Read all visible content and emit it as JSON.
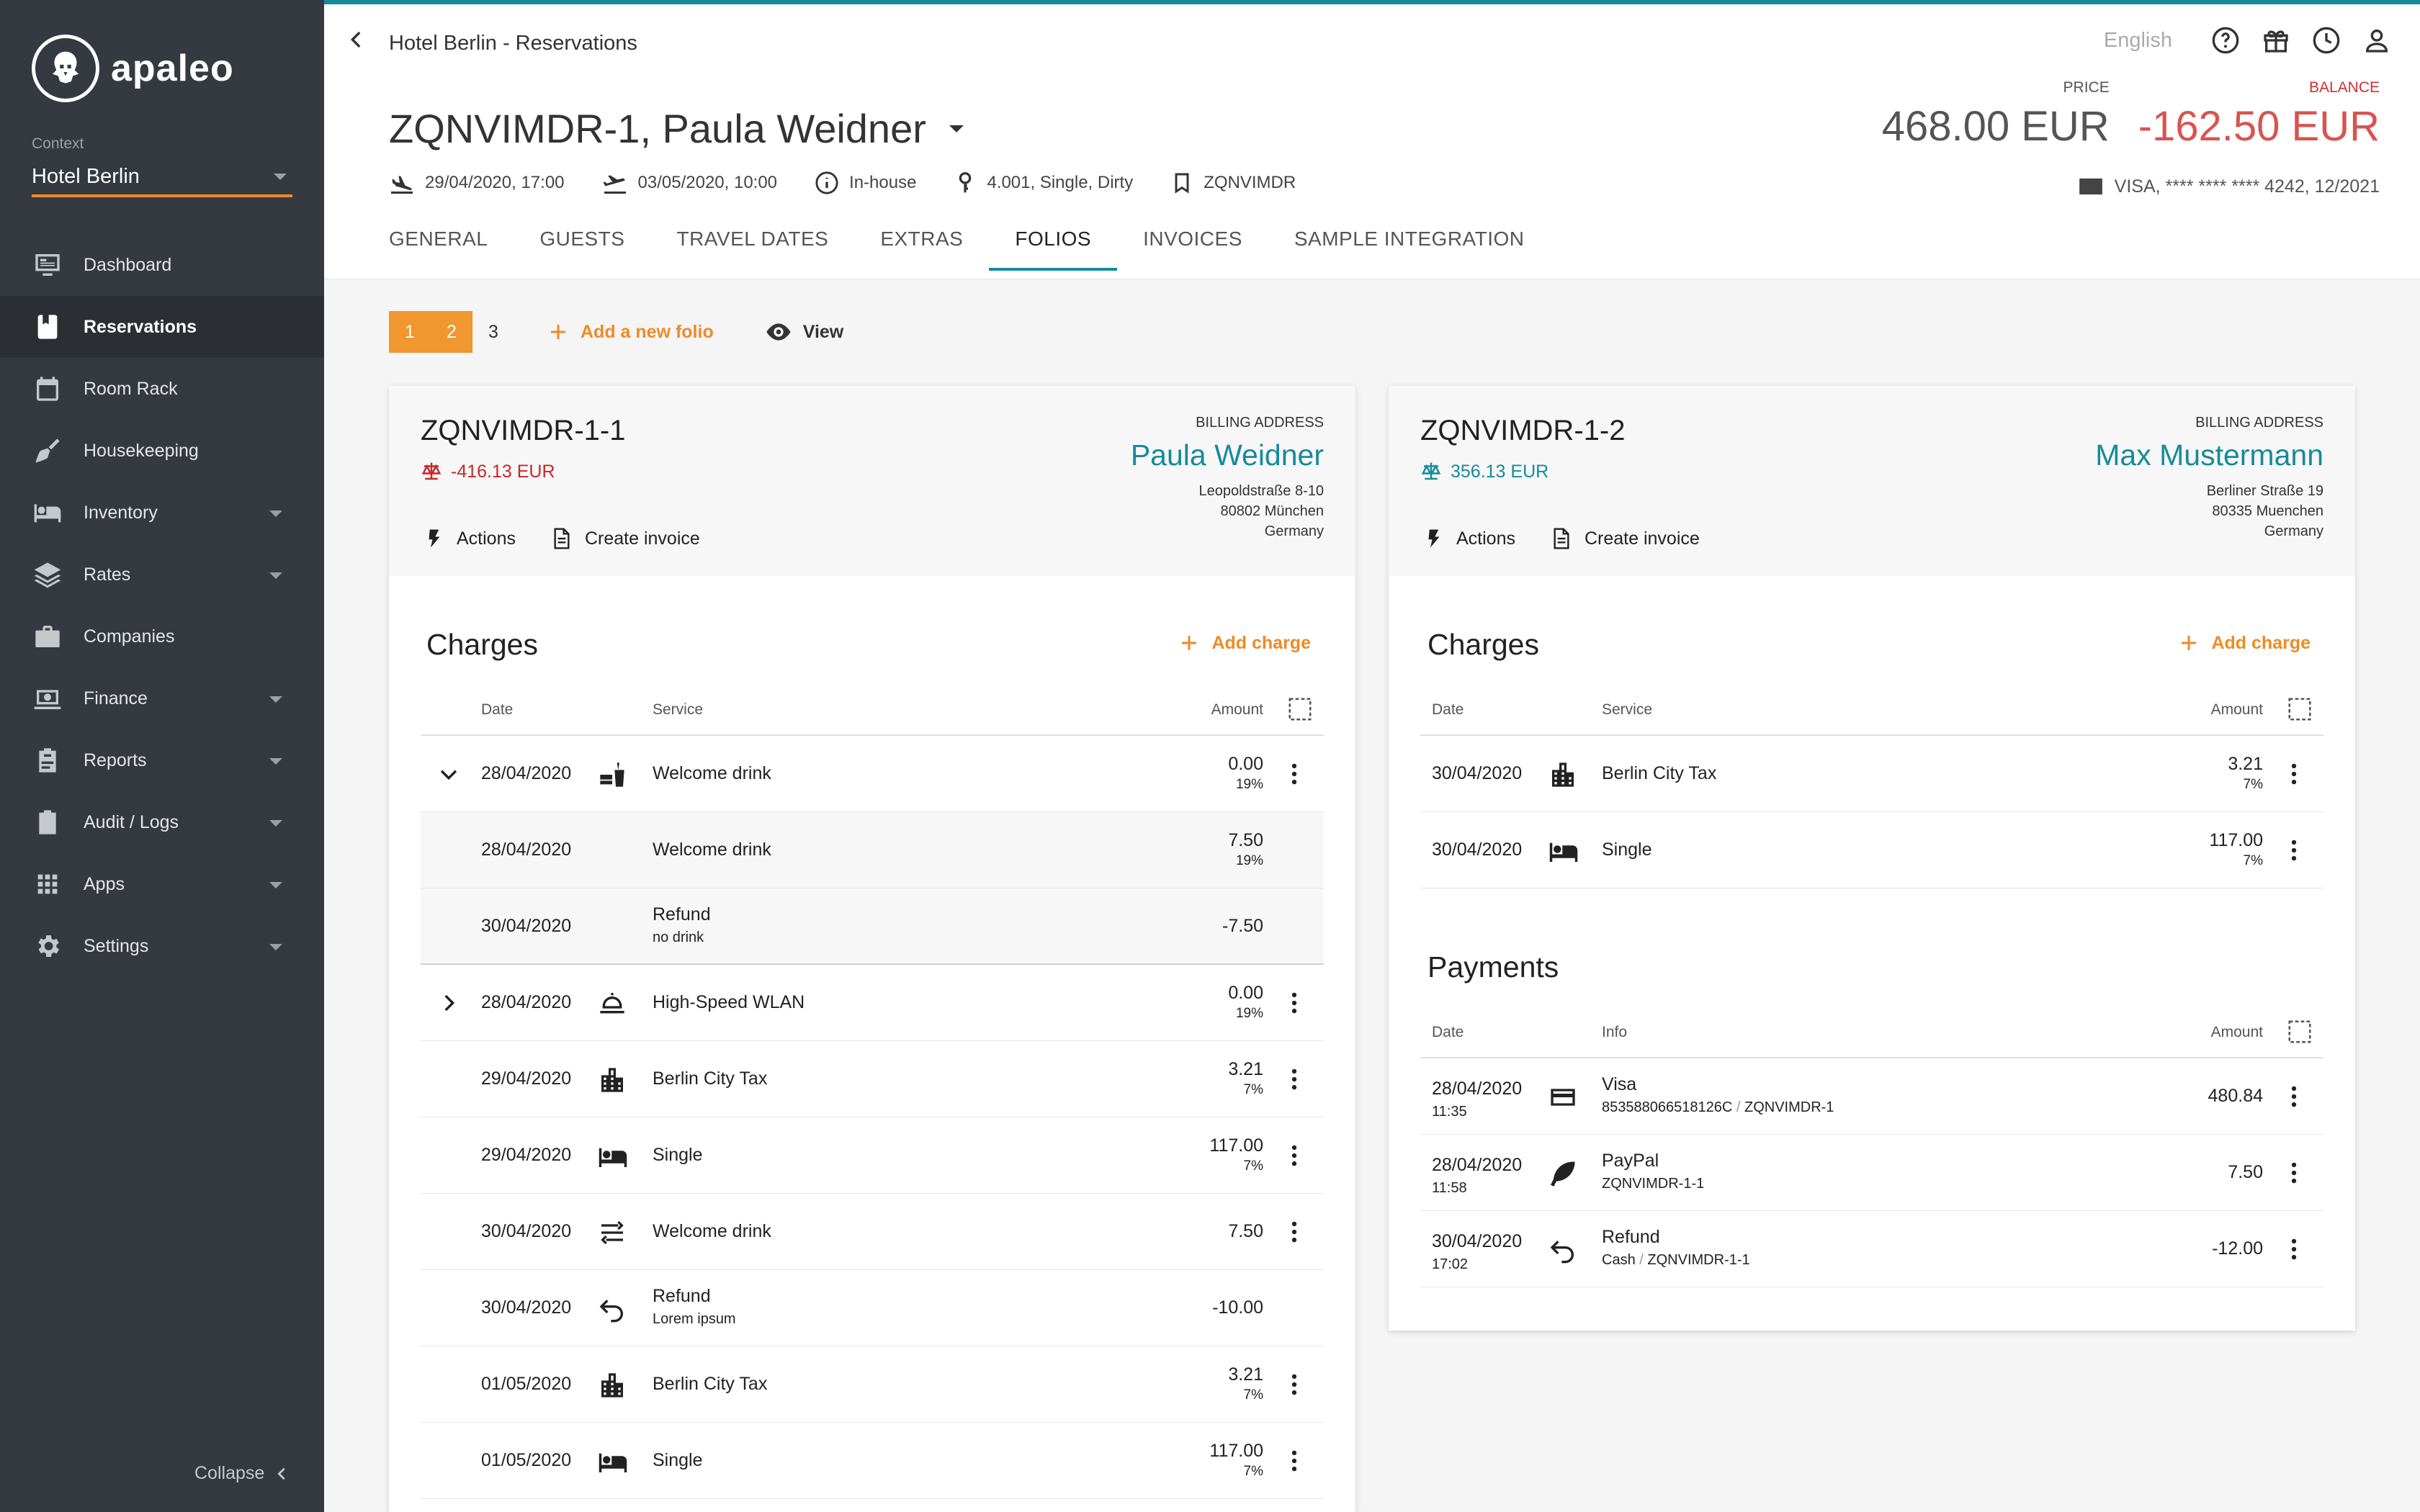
{
  "app": {
    "logo": "apaleo",
    "context_label": "Context",
    "context_value": "Hotel Berlin",
    "collapse": "Collapse"
  },
  "nav": [
    {
      "label": "Dashboard",
      "icon": "dashboard-icon"
    },
    {
      "label": "Reservations",
      "icon": "reservations-icon",
      "active": true
    },
    {
      "label": "Room Rack",
      "icon": "room-rack-icon"
    },
    {
      "label": "Housekeeping",
      "icon": "housekeeping-icon"
    },
    {
      "label": "Inventory",
      "icon": "inventory-icon",
      "caret": true
    },
    {
      "label": "Rates",
      "icon": "rates-icon",
      "caret": true
    },
    {
      "label": "Companies",
      "icon": "companies-icon"
    },
    {
      "label": "Finance",
      "icon": "finance-icon",
      "caret": true
    },
    {
      "label": "Reports",
      "icon": "reports-icon",
      "caret": true
    },
    {
      "label": "Audit / Logs",
      "icon": "audit-icon",
      "caret": true
    },
    {
      "label": "Apps",
      "icon": "apps-icon",
      "caret": true
    },
    {
      "label": "Settings",
      "icon": "settings-icon",
      "caret": true
    }
  ],
  "header": {
    "breadcrumb": "Hotel Berlin - Reservations",
    "language": "English",
    "title": "ZQNVIMDR-1, Paula Weidner",
    "arrival": "29/04/2020, 17:00",
    "departure": "03/05/2020, 10:00",
    "status": "In-house",
    "unit": "4.001, Single, Dirty",
    "booking": "ZQNVIMDR",
    "price_label": "PRICE",
    "price": "468.00 EUR",
    "balance_label": "BALANCE",
    "balance": "-162.50 EUR",
    "card": "VISA, **** **** **** 4242, 12/2021"
  },
  "tabs": [
    {
      "label": "GENERAL"
    },
    {
      "label": "GUESTS"
    },
    {
      "label": "TRAVEL DATES"
    },
    {
      "label": "EXTRAS"
    },
    {
      "label": "FOLIOS",
      "active": true
    },
    {
      "label": "INVOICES"
    },
    {
      "label": "SAMPLE INTEGRATION"
    }
  ],
  "toolbar": {
    "pages": [
      "1",
      "2",
      "3"
    ],
    "add_folio": "Add a new folio",
    "view": "View"
  },
  "folio1": {
    "id": "ZQNVIMDR-1-1",
    "balance": "-416.13 EUR",
    "actions": "Actions",
    "create_invoice": "Create invoice",
    "billing_label": "BILLING ADDRESS",
    "name": "Paula Weidner",
    "address1": "Leopoldstraße 8-10",
    "address2": "80802 München",
    "address3": "Germany",
    "charges_title": "Charges",
    "add_charge": "Add charge",
    "col_date": "Date",
    "col_service": "Service",
    "col_amount": "Amount",
    "rows": [
      {
        "date": "28/04/2020",
        "service": "Welcome drink",
        "amount": "0.00",
        "vat": "19%"
      },
      {
        "date": "28/04/2020",
        "service": "Welcome drink",
        "amount": "7.50",
        "vat": "19%"
      },
      {
        "date": "30/04/2020",
        "service": "Refund",
        "note": "no drink",
        "amount": "-7.50"
      },
      {
        "date": "28/04/2020",
        "service": "High-Speed WLAN",
        "amount": "0.00",
        "vat": "19%"
      },
      {
        "date": "29/04/2020",
        "service": "Berlin City Tax",
        "amount": "3.21",
        "vat": "7%"
      },
      {
        "date": "29/04/2020",
        "service": "Single",
        "amount": "117.00",
        "vat": "7%"
      },
      {
        "date": "30/04/2020",
        "service": "Welcome drink",
        "amount": "7.50"
      },
      {
        "date": "30/04/2020",
        "service": "Refund",
        "note": "Lorem ipsum",
        "amount": "-10.00"
      },
      {
        "date": "01/05/2020",
        "service": "Berlin City Tax",
        "amount": "3.21",
        "vat": "7%"
      },
      {
        "date": "01/05/2020",
        "service": "Single",
        "amount": "117.00",
        "vat": "7%"
      }
    ]
  },
  "folio2": {
    "id": "ZQNVIMDR-1-2",
    "balance": "356.13 EUR",
    "actions": "Actions",
    "create_invoice": "Create invoice",
    "billing_label": "BILLING ADDRESS",
    "name": "Max Mustermann",
    "address1": "Berliner Straße 19",
    "address2": "80335 Muenchen",
    "address3": "Germany",
    "charges_title": "Charges",
    "add_charge": "Add charge",
    "col_date": "Date",
    "col_service": "Service",
    "col_amount": "Amount",
    "rows": [
      {
        "date": "30/04/2020",
        "service": "Berlin City Tax",
        "amount": "3.21",
        "vat": "7%"
      },
      {
        "date": "30/04/2020",
        "service": "Single",
        "amount": "117.00",
        "vat": "7%"
      }
    ],
    "payments_title": "Payments",
    "col_info": "Info",
    "payments": [
      {
        "date": "28/04/2020",
        "time": "11:35",
        "method": "Visa",
        "ref": "853588066518126C",
        "ref2": "ZQNVIMDR-1",
        "amount": "480.84"
      },
      {
        "date": "28/04/2020",
        "time": "11:58",
        "method": "PayPal",
        "ref": "ZQNVIMDR-1-1",
        "amount": "7.50"
      },
      {
        "date": "30/04/2020",
        "time": "17:02",
        "method": "Refund",
        "ref": "Cash",
        "ref2": "ZQNVIMDR-1-1",
        "amount": "-12.00"
      }
    ]
  },
  "colors": {
    "sidebar": "#353a40",
    "accent": "#158b9a",
    "orange": "#ef8a26",
    "negative": "#d9534f"
  }
}
